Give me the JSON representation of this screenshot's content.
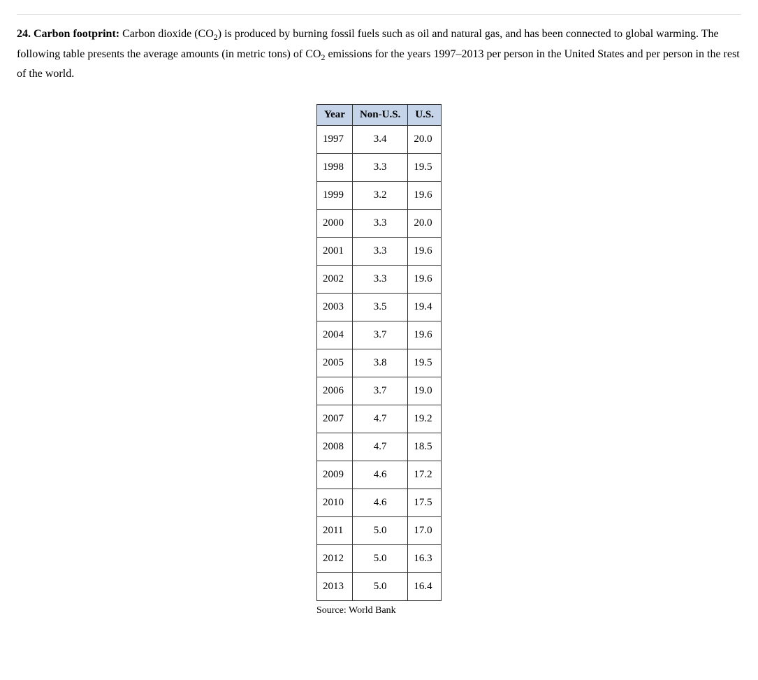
{
  "problem": {
    "number": "24.",
    "title": "Carbon footprint:",
    "text_part1": " Carbon dioxide (CO",
    "sub1": "2",
    "text_part2": ") is produced by burning fossil fuels such as oil and natural gas, and has been connected to global warming. The following table presents the average amounts (in metric tons) of CO",
    "sub2": "2",
    "text_part3": " emissions for the years 1997–2013 per person in the United States and per person in the rest of the world."
  },
  "table": {
    "headers": {
      "col1": "Year",
      "col2": "Non-U.S.",
      "col3": "U.S."
    },
    "rows": [
      {
        "year": "1997",
        "nonus": "3.4",
        "us": "20.0"
      },
      {
        "year": "1998",
        "nonus": "3.3",
        "us": "19.5"
      },
      {
        "year": "1999",
        "nonus": "3.2",
        "us": "19.6"
      },
      {
        "year": "2000",
        "nonus": "3.3",
        "us": "20.0"
      },
      {
        "year": "2001",
        "nonus": "3.3",
        "us": "19.6"
      },
      {
        "year": "2002",
        "nonus": "3.3",
        "us": "19.6"
      },
      {
        "year": "2003",
        "nonus": "3.5",
        "us": "19.4"
      },
      {
        "year": "2004",
        "nonus": "3.7",
        "us": "19.6"
      },
      {
        "year": "2005",
        "nonus": "3.8",
        "us": "19.5"
      },
      {
        "year": "2006",
        "nonus": "3.7",
        "us": "19.0"
      },
      {
        "year": "2007",
        "nonus": "4.7",
        "us": "19.2"
      },
      {
        "year": "2008",
        "nonus": "4.7",
        "us": "18.5"
      },
      {
        "year": "2009",
        "nonus": "4.6",
        "us": "17.2"
      },
      {
        "year": "2010",
        "nonus": "4.6",
        "us": "17.5"
      },
      {
        "year": "2011",
        "nonus": "5.0",
        "us": "17.0"
      },
      {
        "year": "2012",
        "nonus": "5.0",
        "us": "16.3"
      },
      {
        "year": "2013",
        "nonus": "5.0",
        "us": "16.4"
      }
    ],
    "source": "Source: World Bank"
  },
  "chart_data": {
    "type": "table",
    "title": "Average CO2 emissions (metric tons) per person, 1997–2013",
    "columns": [
      "Year",
      "Non-U.S.",
      "U.S."
    ],
    "data": [
      [
        1997,
        3.4,
        20.0
      ],
      [
        1998,
        3.3,
        19.5
      ],
      [
        1999,
        3.2,
        19.6
      ],
      [
        2000,
        3.3,
        20.0
      ],
      [
        2001,
        3.3,
        19.6
      ],
      [
        2002,
        3.3,
        19.6
      ],
      [
        2003,
        3.5,
        19.4
      ],
      [
        2004,
        3.7,
        19.6
      ],
      [
        2005,
        3.8,
        19.5
      ],
      [
        2006,
        3.7,
        19.0
      ],
      [
        2007,
        4.7,
        19.2
      ],
      [
        2008,
        4.7,
        18.5
      ],
      [
        2009,
        4.6,
        17.2
      ],
      [
        2010,
        4.6,
        17.5
      ],
      [
        2011,
        5.0,
        17.0
      ],
      [
        2012,
        5.0,
        16.3
      ],
      [
        2013,
        5.0,
        16.4
      ]
    ]
  }
}
